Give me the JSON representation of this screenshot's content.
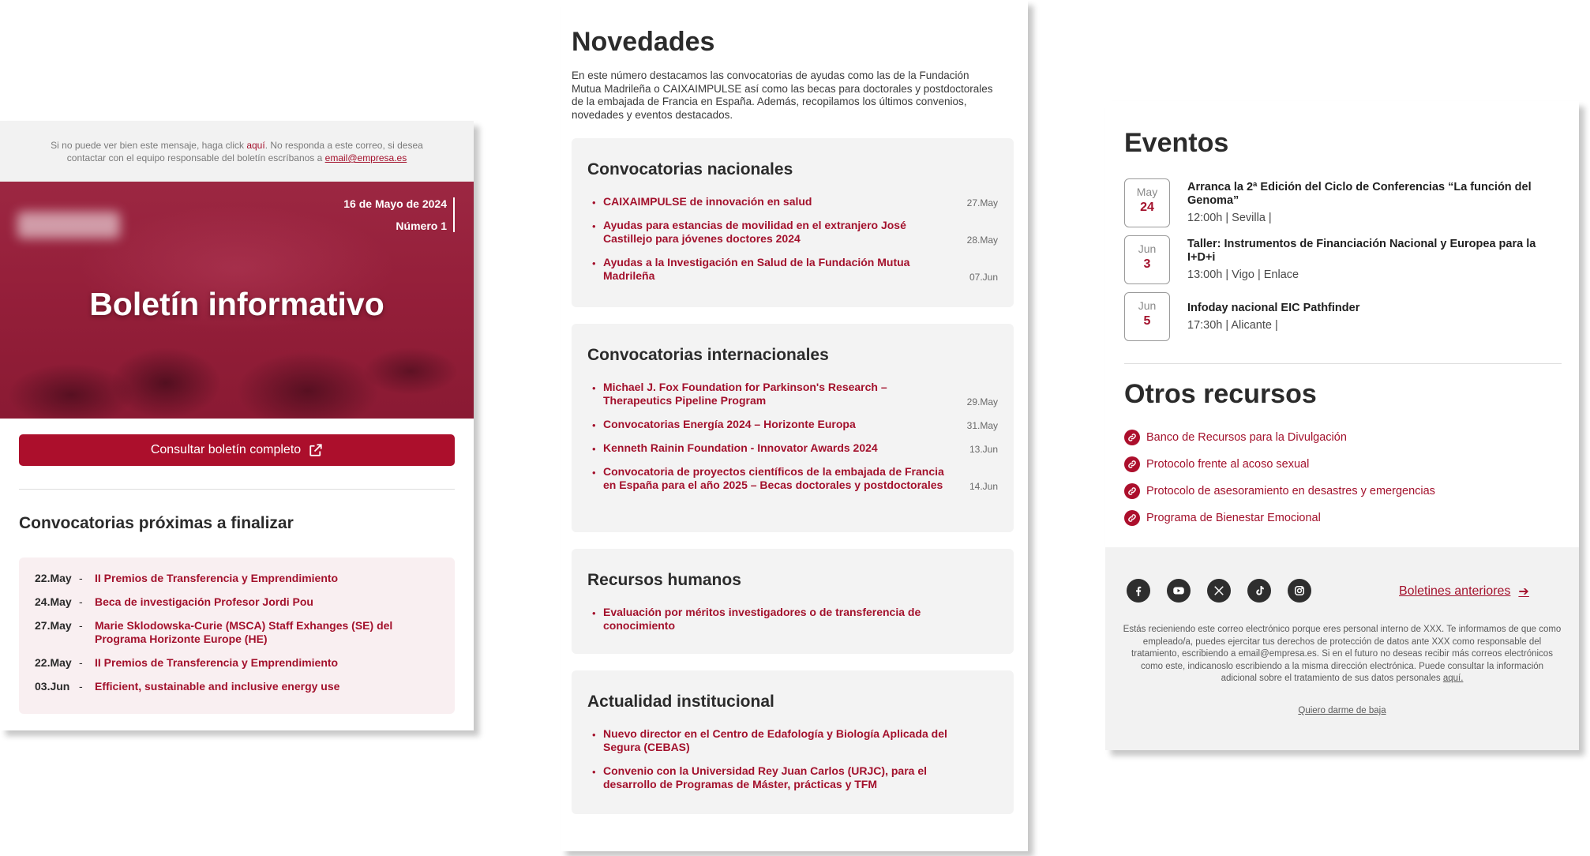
{
  "left": {
    "topnote": {
      "pre": "Si no puede ver bien este mensaje, haga click ",
      "link": "aquí",
      "mid": ". No responda a este correo, si desea contactar con el equipo responsable del boletín escríbanos a ",
      "email": "email@empresa.es"
    },
    "hero": {
      "date": "16 de Mayo de 2024",
      "number": "Número 1",
      "title": "Boletín informativo"
    },
    "cta_label": "Consultar boletín completo",
    "ending_title": "Convocatorias próximas a finalizar",
    "ending": [
      {
        "date": "22.May",
        "title": "II Premios de Transferencia y Emprendimiento"
      },
      {
        "date": "24.May",
        "title": "Beca de investigación Profesor Jordi Pou"
      },
      {
        "date": "27.May",
        "title": "Marie Sklodowska-Curie (MSCA) Staff Exhanges (SE) del Programa Horizonte Europe (HE)"
      },
      {
        "date": "22.May",
        "title": "II Premios de Transferencia y Emprendimiento"
      },
      {
        "date": "03.Jun",
        "title": "Efficient, sustainable and inclusive energy use"
      }
    ]
  },
  "mid": {
    "title": "Novedades",
    "intro": "En este número destacamos las convocatorias de ayudas como las de la Fundación Mutua Madrileña o CAIXAIMPULSE así como las becas para doctorales y postdoctorales de la embajada de Francia en España. Además, recopilamos los últimos convenios, novedades y eventos destacados.",
    "sections": [
      {
        "title": "Convocatorias nacionales",
        "items": [
          {
            "text": "CAIXAIMPULSE de innovación en salud",
            "date": "27.May"
          },
          {
            "text": "Ayudas para estancias de movilidad en el extranjero José Castillejo para jóvenes doctores 2024",
            "date": "28.May"
          },
          {
            "text": "Ayudas a la Investigación en Salud de la Fundación Mutua Madrileña",
            "date": "07.Jun"
          }
        ]
      },
      {
        "title": "Convocatorias internacionales",
        "items": [
          {
            "text": "Michael J. Fox Foundation for Parkinson's Research – Therapeutics Pipeline Program",
            "date": "29.May"
          },
          {
            "text": "Convocatorias Energía 2024 – Horizonte Europa",
            "date": "31.May"
          },
          {
            "text": "Kenneth Rainin Foundation - Innovator Awards 2024",
            "date": "13.Jun"
          },
          {
            "text": "Convocatoria de proyectos científicos de la embajada de Francia en España para el año 2025 – Becas doctorales y postdoctorales",
            "date": "14.Jun"
          }
        ]
      },
      {
        "title": "Recursos humanos",
        "items": [
          {
            "text": "Evaluación por méritos investigadores o de transferencia de conocimiento",
            "date": ""
          }
        ]
      },
      {
        "title": "Actualidad institucional",
        "items": [
          {
            "text": "Nuevo director en el Centro de Edafología y Biología Aplicada del Segura (CEBAS)",
            "date": ""
          },
          {
            "text": "Convenio con la Universidad Rey Juan Carlos (URJC), para el desarrollo de Programas de Máster, prácticas y TFM",
            "date": ""
          }
        ]
      }
    ]
  },
  "right": {
    "events_title": "Eventos",
    "events": [
      {
        "month": "May",
        "day": "24",
        "title": "Arranca la 2ª Edición del Ciclo de Conferencias “La función del Genoma”",
        "meta": "12:00h  |  Sevilla  |"
      },
      {
        "month": "Jun",
        "day": "3",
        "title": "Taller: Instrumentos de Financiación Nacional y Europea para la I+D+i",
        "meta": "13:00h  |  Vigo  |  Enlace"
      },
      {
        "month": "Jun",
        "day": "5",
        "title": "Infoday nacional EIC Pathfinder",
        "meta": "17:30h  |  Alicante  |"
      }
    ],
    "resources_title": "Otros recursos",
    "resources": [
      "Banco de Recursos para la Divulgación",
      "Protocolo frente al acoso sexual",
      "Protocolo de asesoramiento en desastres y emergencias",
      "Programa de Bienestar Emocional"
    ],
    "social": [
      "facebook-icon",
      "youtube-icon",
      "x-icon",
      "tiktok-icon",
      "instagram-icon"
    ],
    "prev_label": "Boletines anteriores",
    "legal": "Estás recieniendo este correo electrónico porque eres personal interno de XXX. Te informamos de que como empleado/a, puedes ejercitar tus derechos de protección de datos ante XXX como responsable del tratamiento, escribiendo a email@empresa.es. Si en el futuro no deseas recibir más correos electrónicos como este, indicanoslo escribiendo a la misma dirección electrónica. Puede consultar la información adicional sobre el tratamiento de sus datos personales ",
    "legal_link": "aquí.",
    "unsubscribe": "Quiero darme de baja"
  },
  "colors": {
    "accent": "#ac0f2c",
    "link": "#a3112c",
    "panel_gray": "#f3f3f3",
    "tint": "#f9eff1"
  }
}
